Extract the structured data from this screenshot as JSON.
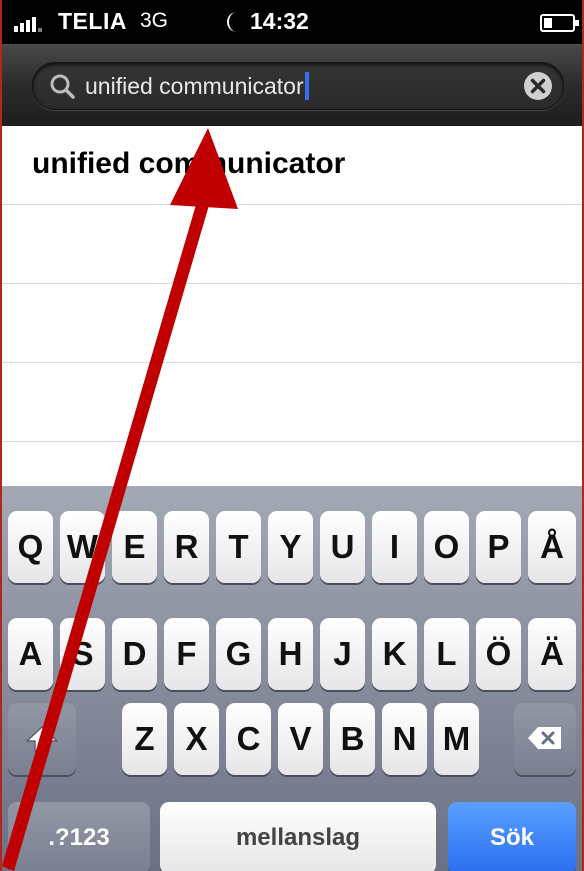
{
  "status_bar": {
    "carrier": "TELIA",
    "network": "3G",
    "time": "14:32",
    "icons": [
      "signal-icon",
      "moon-icon",
      "battery-icon"
    ]
  },
  "search": {
    "query": "unified communicator",
    "icons": [
      "search-icon",
      "clear-icon"
    ]
  },
  "results": {
    "suggestions": [
      "unified communicator"
    ]
  },
  "keyboard": {
    "row1": [
      "Q",
      "W",
      "E",
      "R",
      "T",
      "Y",
      "U",
      "I",
      "O",
      "P",
      "Å"
    ],
    "row2": [
      "A",
      "S",
      "D",
      "F",
      "G",
      "H",
      "J",
      "K",
      "L",
      "Ö",
      "Ä"
    ],
    "row3": [
      "Z",
      "X",
      "C",
      "V",
      "B",
      "N",
      "M"
    ],
    "numbers_label": ".?123",
    "space_label": "mellanslag",
    "search_label": "Sök",
    "icons": [
      "shift-icon",
      "backspace-icon"
    ]
  },
  "colors": {
    "annotation_arrow": "#c00000",
    "search_key": "#2a6ef0",
    "cursor": "#3a6cf0"
  }
}
